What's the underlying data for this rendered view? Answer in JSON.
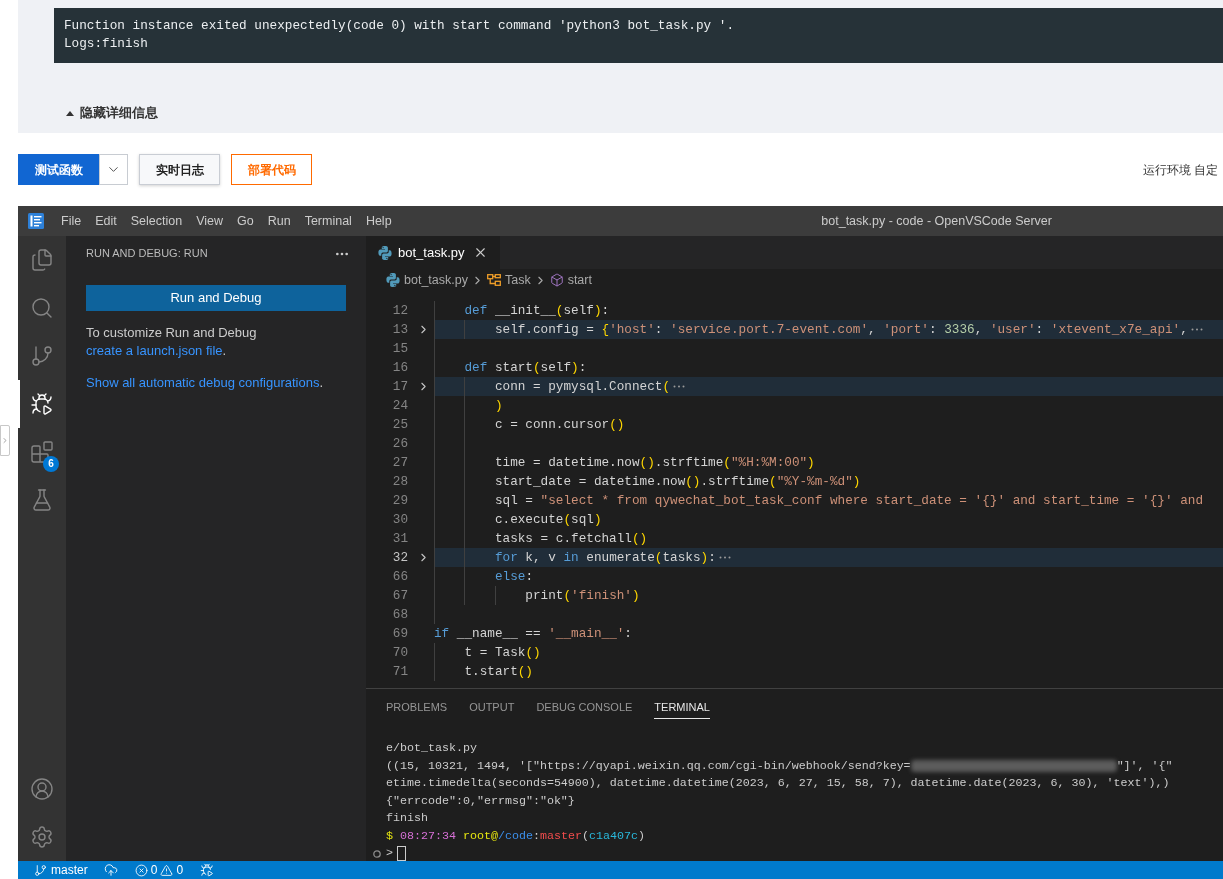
{
  "function_log": {
    "lines": [
      "Function instance exited unexpectedly(code 0) with start command 'python3 bot_task.py '.",
      "Logs:finish"
    ],
    "toggle": {
      "label": "隐藏详细信息",
      "expanded": true
    }
  },
  "toolbar": {
    "buttons": [
      {
        "label": "测试函数",
        "kind": "primary"
      },
      {
        "label": "实时日志",
        "kind": "secondary"
      },
      {
        "label": "部署代码",
        "kind": "outline"
      }
    ],
    "runtime_label": "运行环境 自定"
  },
  "editor_window": {
    "menu": [
      "File",
      "Edit",
      "Selection",
      "View",
      "Go",
      "Run",
      "Terminal",
      "Help"
    ],
    "title": "bot_task.py - code - OpenVSCode Server",
    "activity_bar": {
      "top_items": [
        {
          "selected": false
        },
        {
          "selected": false
        },
        {
          "selected": false
        },
        {
          "selected": true
        },
        {
          "selected": false,
          "badge": "6"
        },
        {
          "selected": false
        }
      ]
    },
    "sidebar": {
      "title": "RUN AND DEBUG: RUN",
      "run_button": "Run and Debug",
      "hint": {
        "text": "To customize Run and Debug",
        "link": "create a launch.json file",
        "after": "."
      },
      "show_all": {
        "link": "Show all automatic debug configurations",
        "after": "."
      }
    },
    "tabs": [
      {
        "label": "bot_task.py",
        "selected": true
      }
    ],
    "breadcrumbs": [
      "bot_task.py",
      "Task",
      "start"
    ],
    "code_lines": [
      {
        "children": [
          {
            "number": "12",
            "folded": false,
            "current": false,
            "tokens": [
              {
                "text": "def",
                "kind": "keyword"
              },
              {
                "text": " __init__",
                "kind": "plain"
              },
              {
                "text": "(",
                "kind": "bracket"
              },
              {
                "text": "self",
                "kind": "plain"
              },
              {
                "text": ")",
                "kind": "bracket"
              },
              {
                "text": ":",
                "kind": "plain"
              }
            ],
            "children": [
              {
                "number": "13",
                "folded": true,
                "current": false,
                "tokens": [
                  {
                    "text": "self.config = ",
                    "kind": "plain"
                  },
                  {
                    "text": "{",
                    "kind": "bracket"
                  },
                  {
                    "text": "'host'",
                    "kind": "string"
                  },
                  {
                    "text": ": ",
                    "kind": "plain"
                  },
                  {
                    "text": "'service.port.7-event.com'",
                    "kind": "string"
                  },
                  {
                    "text": ", ",
                    "kind": "plain"
                  },
                  {
                    "text": "'port'",
                    "kind": "string"
                  },
                  {
                    "text": ": ",
                    "kind": "plain"
                  },
                  {
                    "text": "3336",
                    "kind": "number"
                  },
                  {
                    "text": ", ",
                    "kind": "plain"
                  },
                  {
                    "text": "'user'",
                    "kind": "string"
                  },
                  {
                    "text": ": ",
                    "kind": "plain"
                  },
                  {
                    "text": "'xtevent_x7e_api'",
                    "kind": "string"
                  },
                  {
                    "text": ",",
                    "kind": "plain"
                  }
                ]
              }
            ]
          },
          {
            "number": "15",
            "folded": false,
            "current": false
          },
          {
            "number": "16",
            "folded": false,
            "current": false,
            "tokens": [
              {
                "text": "def",
                "kind": "keyword"
              },
              {
                "text": " start",
                "kind": "plain"
              },
              {
                "text": "(",
                "kind": "bracket"
              },
              {
                "text": "self",
                "kind": "plain"
              },
              {
                "text": ")",
                "kind": "bracket"
              },
              {
                "text": ":",
                "kind": "plain"
              }
            ],
            "children": [
              {
                "number": "17",
                "folded": true,
                "current": false,
                "tokens": [
                  {
                    "text": "conn = pymysql.Connect",
                    "kind": "plain"
                  },
                  {
                    "text": "(",
                    "kind": "bracket"
                  }
                ]
              },
              {
                "number": "24",
                "folded": false,
                "current": false,
                "tokens": [
                  {
                    "text": ")",
                    "kind": "bracket"
                  }
                ]
              },
              {
                "number": "25",
                "folded": false,
                "current": false,
                "tokens": [
                  {
                    "text": "c = conn.cursor",
                    "kind": "plain"
                  },
                  {
                    "text": "()",
                    "kind": "bracket"
                  }
                ]
              },
              {
                "number": "26",
                "folded": false,
                "current": false
              },
              {
                "number": "27",
                "folded": false,
                "current": false,
                "tokens": [
                  {
                    "text": "time = datetime.now",
                    "kind": "plain"
                  },
                  {
                    "text": "()",
                    "kind": "bracket"
                  },
                  {
                    "text": ".strftime",
                    "kind": "plain"
                  },
                  {
                    "text": "(",
                    "kind": "bracket"
                  },
                  {
                    "text": "\"%H:%M:00\"",
                    "kind": "string"
                  },
                  {
                    "text": ")",
                    "kind": "bracket"
                  }
                ]
              },
              {
                "number": "28",
                "folded": false,
                "current": false,
                "tokens": [
                  {
                    "text": "start_date = datetime.now",
                    "kind": "plain"
                  },
                  {
                    "text": "()",
                    "kind": "bracket"
                  },
                  {
                    "text": ".strftime",
                    "kind": "plain"
                  },
                  {
                    "text": "(",
                    "kind": "bracket"
                  },
                  {
                    "text": "\"%Y-%m-%d\"",
                    "kind": "string"
                  },
                  {
                    "text": ")",
                    "kind": "bracket"
                  }
                ]
              },
              {
                "number": "29",
                "folded": false,
                "current": false,
                "tokens": [
                  {
                    "text": "sql = ",
                    "kind": "plain"
                  },
                  {
                    "text": "\"select * from qywechat_bot_task_conf where start_date = '{}' and start_time = '{}' and",
                    "kind": "string"
                  }
                ]
              },
              {
                "number": "30",
                "folded": false,
                "current": false,
                "tokens": [
                  {
                    "text": "c.execute",
                    "kind": "plain"
                  },
                  {
                    "text": "(",
                    "kind": "bracket"
                  },
                  {
                    "text": "sql",
                    "kind": "plain"
                  },
                  {
                    "text": ")",
                    "kind": "bracket"
                  }
                ]
              },
              {
                "number": "31",
                "folded": false,
                "current": false,
                "tokens": [
                  {
                    "text": "tasks = c.fetchall",
                    "kind": "plain"
                  },
                  {
                    "text": "()",
                    "kind": "bracket"
                  }
                ]
              },
              {
                "number": "32",
                "folded": true,
                "current": true,
                "tokens": [
                  {
                    "text": "for",
                    "kind": "keyword"
                  },
                  {
                    "text": " k, v ",
                    "kind": "plain"
                  },
                  {
                    "text": "in",
                    "kind": "keyword"
                  },
                  {
                    "text": " enumerate",
                    "kind": "plain"
                  },
                  {
                    "text": "(",
                    "kind": "bracket"
                  },
                  {
                    "text": "tasks",
                    "kind": "plain"
                  },
                  {
                    "text": ")",
                    "kind": "bracket"
                  },
                  {
                    "text": ":",
                    "kind": "plain"
                  }
                ]
              },
              {
                "number": "66",
                "folded": false,
                "current": false,
                "tokens": [
                  {
                    "text": "else",
                    "kind": "keyword"
                  },
                  {
                    "text": ":",
                    "kind": "plain"
                  }
                ],
                "children": [
                  {
                    "number": "67",
                    "folded": false,
                    "current": false,
                    "tokens": [
                      {
                        "text": "print",
                        "kind": "plain"
                      },
                      {
                        "text": "(",
                        "kind": "bracket"
                      },
                      {
                        "text": "'finish'",
                        "kind": "string"
                      },
                      {
                        "text": ")",
                        "kind": "bracket"
                      }
                    ]
                  }
                ]
              }
            ]
          },
          {
            "number": "68",
            "folded": false,
            "current": false
          }
        ]
      },
      {
        "number": "69",
        "folded": false,
        "current": false,
        "tokens": [
          {
            "text": "if",
            "kind": "keyword"
          },
          {
            "text": " __name__ == ",
            "kind": "plain"
          },
          {
            "text": "'__main__'",
            "kind": "string"
          },
          {
            "text": ":",
            "kind": "plain"
          }
        ],
        "children": [
          {
            "number": "70",
            "folded": false,
            "current": false,
            "tokens": [
              {
                "text": "t = Task",
                "kind": "plain"
              },
              {
                "text": "()",
                "kind": "bracket"
              }
            ]
          },
          {
            "number": "71",
            "folded": false,
            "current": false,
            "tokens": [
              {
                "text": "t.start",
                "kind": "plain"
              },
              {
                "text": "()",
                "kind": "bracket"
              }
            ]
          }
        ]
      }
    ],
    "panel_tabs": [
      {
        "label": "PROBLEMS",
        "selected": false
      },
      {
        "label": "OUTPUT",
        "selected": false
      },
      {
        "label": "DEBUG CONSOLE",
        "selected": false
      },
      {
        "label": "TERMINAL",
        "selected": true
      }
    ],
    "terminal_lines": [
      {
        "kind": "output",
        "segments": [
          {
            "text": "e/bot_task.py",
            "kind": "plain"
          }
        ]
      },
      {
        "kind": "output",
        "segments": [
          {
            "text": "((15, 10321, 1494, '[\"https://qyapi.weixin.qq.com/cgi-bin/webhook/send?key=",
            "kind": "plain"
          },
          {
            "kind": "redacted"
          },
          {
            "text": "\"]', '{\"",
            "kind": "plain"
          }
        ]
      },
      {
        "kind": "output",
        "segments": [
          {
            "text": "etime.timedelta(seconds=54900), datetime.datetime(2023, 6, 27, 15, 58, 7), datetime.date(2023, 6, 30), 'text'),)",
            "kind": "plain"
          }
        ]
      },
      {
        "kind": "output",
        "segments": [
          {
            "text": "{\"errcode\":0,\"errmsg\":\"ok\"}",
            "kind": "plain"
          }
        ]
      },
      {
        "kind": "output",
        "segments": [
          {
            "text": "finish",
            "kind": "plain"
          }
        ]
      },
      {
        "kind": "prompt",
        "segments": [
          {
            "text": "$ ",
            "kind": "prompt"
          },
          {
            "text": "08:27:34 ",
            "kind": "time"
          },
          {
            "text": "root@",
            "kind": "user"
          },
          {
            "text": "/code",
            "kind": "path"
          },
          {
            "text": ":",
            "kind": "plain"
          },
          {
            "text": "master",
            "kind": "branch"
          },
          {
            "text": "(",
            "kind": "plain"
          },
          {
            "text": "c1a407c",
            "kind": "commit"
          },
          {
            "text": ")",
            "kind": "plain"
          }
        ]
      },
      {
        "kind": "input",
        "prompt": ">"
      }
    ],
    "status_bar": {
      "branch": "master",
      "errors": "0",
      "warnings": "0"
    }
  }
}
